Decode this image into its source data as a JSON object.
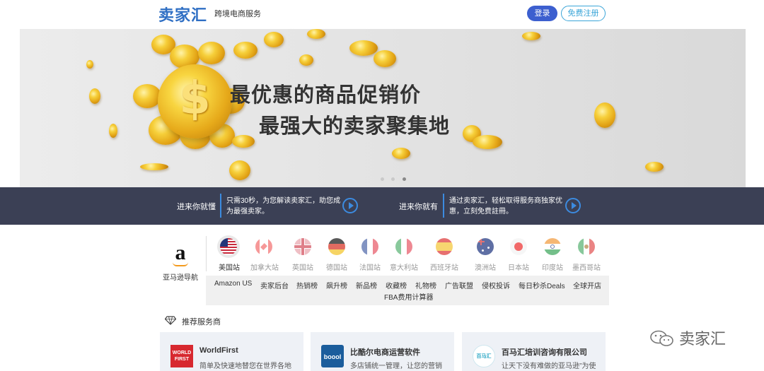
{
  "header": {
    "logo": "卖家汇",
    "tagline": "跨境电商服务",
    "login_label": "登录",
    "register_label": "免费注册"
  },
  "banner": {
    "line1": "最优惠的商品促销价",
    "line2": "最强大的卖家聚集地",
    "currency_symbol": "$",
    "slides": 3,
    "active_slide": 3
  },
  "infobar": {
    "left": {
      "title": "进来你就懂",
      "text": "只需30秒，为您解读卖家汇，助您成为最强卖家。"
    },
    "right": {
      "title": "进来你就有",
      "text": "通过卖家汇，轻松取得服务商独家优惠，立刻免费註冊。"
    }
  },
  "amazon_nav": {
    "logo_letter": "a",
    "label": "亚马逊导航",
    "sites": [
      {
        "label": "美国站",
        "active": true
      },
      {
        "label": "加拿大站",
        "active": false
      },
      {
        "label": "英国站",
        "active": false
      },
      {
        "label": "德国站",
        "active": false
      },
      {
        "label": "法国站",
        "active": false
      },
      {
        "label": "意大利站",
        "active": false
      },
      {
        "label": "西班牙站",
        "active": false
      },
      {
        "label": "澳洲站",
        "active": false
      },
      {
        "label": "日本站",
        "active": false
      },
      {
        "label": "印度站",
        "active": false
      },
      {
        "label": "墨西哥站",
        "active": false
      }
    ],
    "links": [
      "Amazon US",
      "卖家后台",
      "热销榜",
      "飙升榜",
      "新品榜",
      "收藏榜",
      "礼物榜",
      "广告联盟",
      "侵权投诉",
      "每日秒杀Deals",
      "全球开店",
      "FBA费用计算器"
    ]
  },
  "recommended": {
    "title": "推荐服务商",
    "cards": [
      {
        "name": "WorldFirst",
        "desc": "简单及快速地替您在世界各地",
        "logo_text": "WORLD FIRST",
        "logo_color": "#d7282f"
      },
      {
        "name": "比酷尔电商运营软件",
        "desc": "多店铺统一管理，让您的营销",
        "logo_text": "boool",
        "logo_color": "#1b5d9c"
      },
      {
        "name": "百马汇培训咨询有限公司",
        "desc": "让天下没有难做的亚马逊”为使",
        "logo_text": "百马汇",
        "logo_color": "#27a6c4"
      }
    ]
  },
  "watermark": "卖家汇",
  "colors": {
    "brand_blue": "#2f6fc4",
    "login_bg": "#3c5fcf",
    "register_border": "#3aa5d8",
    "infobar_bg": "#3b4055",
    "accent_blue": "#3c8be0",
    "coin_gold": "#e3a416"
  }
}
